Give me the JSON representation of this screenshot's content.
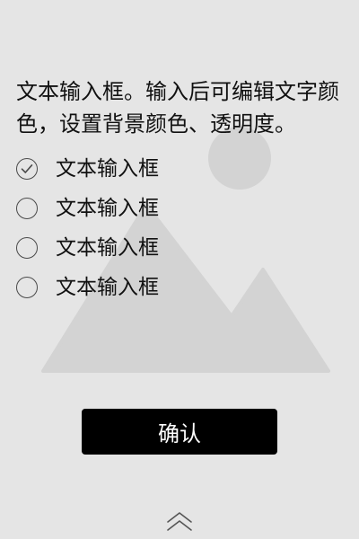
{
  "question": {
    "text": "文本输入框。输入后可编辑文字颜色，设置背景颜色、透明度。"
  },
  "options": [
    {
      "label": "文本输入框",
      "selected": true
    },
    {
      "label": "文本输入框",
      "selected": false
    },
    {
      "label": "文本输入框",
      "selected": false
    },
    {
      "label": "文本输入框",
      "selected": false
    }
  ],
  "confirm_button": {
    "label": "确认"
  },
  "colors": {
    "background": "#e5e5e5",
    "placeholder_shape": "#d3d3d3",
    "button_bg": "#000000",
    "button_text": "#ffffff",
    "radio_border": "#4a4a4a"
  },
  "icons": {
    "placeholder": "image-placeholder-icon",
    "selected_mark": "check-icon",
    "scroll": "double-chevron-up-icon"
  }
}
